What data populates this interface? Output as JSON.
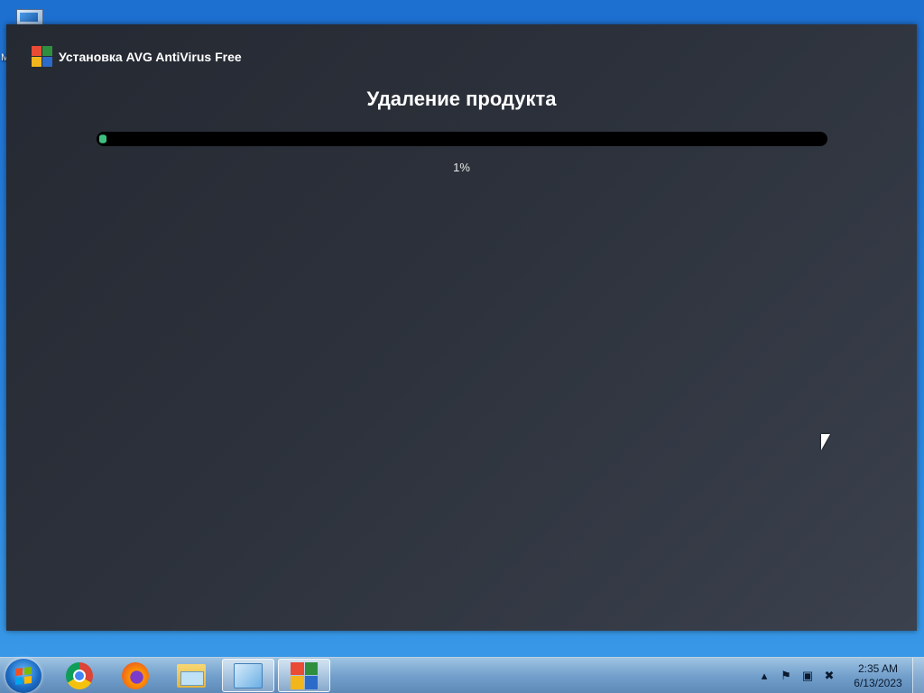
{
  "installer": {
    "title": "Установка AVG AntiVirus Free",
    "heading": "Удаление продукта",
    "progress_percent": 1,
    "progress_label": "1%"
  },
  "colors": {
    "progress_fill": "#3fbf7f",
    "progress_track": "#000000"
  },
  "desktop": {
    "partial_icon_label": "M"
  },
  "taskbar": {
    "pinned": [
      {
        "icon": "start-windows-icon"
      },
      {
        "icon": "chrome-icon"
      },
      {
        "icon": "firefox-icon"
      },
      {
        "icon": "file-explorer-icon"
      },
      {
        "icon": "control-panel-icon"
      },
      {
        "icon": "avg-icon"
      }
    ],
    "tray_icons": [
      "show-hidden-icons",
      "action-center-flag-icon",
      "network-icon",
      "volume-muted-icon"
    ],
    "clock": {
      "time": "2:35 AM",
      "date": "6/13/2023"
    }
  }
}
